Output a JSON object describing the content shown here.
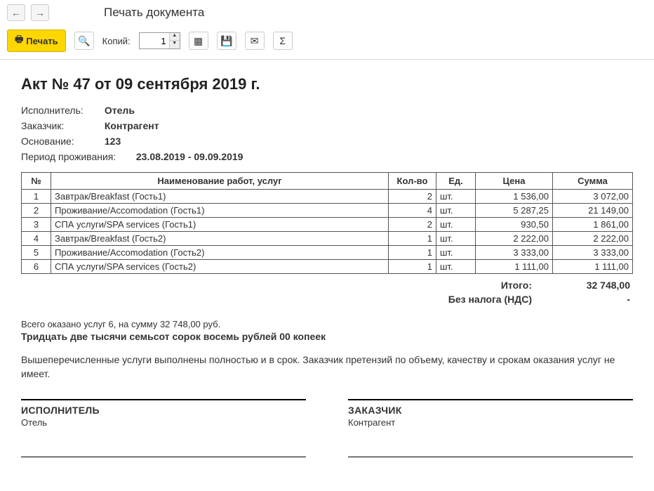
{
  "header": {
    "page_title": "Печать документа"
  },
  "toolbar": {
    "print_label": "Печать",
    "copies_label": "Копий:",
    "copies_value": "1"
  },
  "document": {
    "title": "Акт № 47 от 09 сентября 2019 г.",
    "executor_label": "Исполнитель:",
    "executor_value": "Отель",
    "customer_label": "Заказчик:",
    "customer_value": "Контрагент",
    "basis_label": "Основание:",
    "basis_value": "123",
    "period_label": "Период проживания:",
    "period_value": "23.08.2019 - 09.09.2019",
    "table_headers": {
      "num": "№",
      "name": "Наименование работ, услуг",
      "qty": "Кол-во",
      "unit": "Ед.",
      "price": "Цена",
      "sum": "Сумма"
    },
    "rows": [
      {
        "num": "1",
        "name": "Завтрак/Breakfast (Гость1)",
        "qty": "2",
        "unit": "шт.",
        "price": "1 536,00",
        "sum": "3 072,00"
      },
      {
        "num": "2",
        "name": "Проживание/Accomodation (Гость1)",
        "qty": "4",
        "unit": "шт.",
        "price": "5 287,25",
        "sum": "21 149,00"
      },
      {
        "num": "3",
        "name": "СПА услуги/SPA services (Гость1)",
        "qty": "2",
        "unit": "шт.",
        "price": "930,50",
        "sum": "1 861,00"
      },
      {
        "num": "4",
        "name": "Завтрак/Breakfast (Гость2)",
        "qty": "1",
        "unit": "шт.",
        "price": "2 222,00",
        "sum": "2 222,00"
      },
      {
        "num": "5",
        "name": "Проживание/Accomodation (Гость2)",
        "qty": "1",
        "unit": "шт.",
        "price": "3 333,00",
        "sum": "3 333,00"
      },
      {
        "num": "6",
        "name": "СПА услуги/SPA services (Гость2)",
        "qty": "1",
        "unit": "шт.",
        "price": "1 111,00",
        "sum": "1 111,00"
      }
    ],
    "totals": {
      "total_label": "Итого:",
      "total_value": "32 748,00",
      "tax_label": "Без налога (НДС)",
      "tax_value": "-"
    },
    "summary_line": "Всего оказано услуг 6, на сумму 32 748,00 руб.",
    "summary_words": "Тридцать две тысячи семьсот сорок восемь рублей 00 копеек",
    "disclaimer": "Вышеперечисленные услуги выполнены полностью и в срок. Заказчик претензий по объему, качеству и срокам оказания услуг не имеет.",
    "sign": {
      "executor_title": "ИСПОЛНИТЕЛЬ",
      "executor_name": "Отель",
      "customer_title": "ЗАКАЗЧИК",
      "customer_name": "Контрагент"
    }
  }
}
